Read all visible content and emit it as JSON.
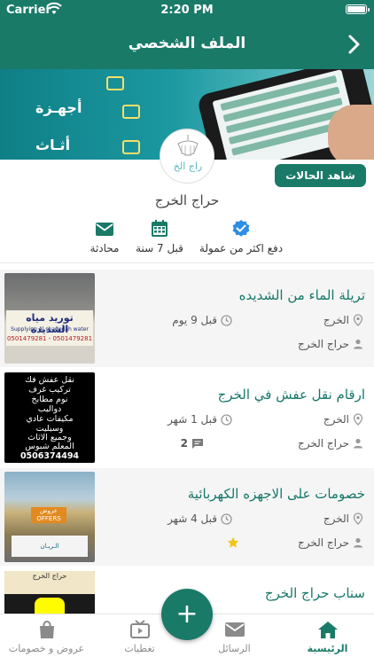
{
  "status_bar": {
    "carrier": "Carrier",
    "time": "2:20 PM"
  },
  "header": {
    "title": "الملف الشخصي",
    "back_icon": "chevron-right-icon"
  },
  "banner": {
    "lines": [
      "أجهـزة",
      "أثـاث"
    ]
  },
  "avatar": {
    "logo_text": "راج الخ"
  },
  "profile": {
    "status_button": "شاهد الحالات",
    "name": "حراج الخرج",
    "stats": [
      {
        "icon": "verified-badge-icon",
        "label": "دفع اكثر من عمولة"
      },
      {
        "icon": "calendar-icon",
        "label": "قبل 7 سنة"
      },
      {
        "icon": "message-icon",
        "label": "محادثة"
      }
    ]
  },
  "listings": [
    {
      "title": "تريلة الماء من الشديده",
      "location": "الخرج",
      "time": "قبل 9 يوم",
      "author": "حراج الخرج",
      "thumb_text": [
        "توريد مياه الشديدة",
        "Supplying Al shadedah water",
        "0501479281 - 0501479281"
      ]
    },
    {
      "title": "ارقام نقل عفش في الخرج",
      "location": "الخرج",
      "time": "قبل 1 شهر",
      "author": "حراج الخرج",
      "comments": "2",
      "thumb_text": [
        "نقل عفش فك",
        "تركيب غرف",
        "نوم مطابخ",
        "دواليب",
        "مكيفات عادي",
        "وسبليت",
        "وجميع الاثاث",
        "المعلم شبوس",
        "0506374494"
      ]
    },
    {
      "title": "خصومات على الاجهزه الكهربائية",
      "location": "الخرج",
      "time": "قبل 4 شهر",
      "author": "حراج الخرج",
      "thumb_text": [
        "عروض OFFERS",
        "الـريـان"
      ]
    },
    {
      "title": "سناب حراج الخرج",
      "thumb_text": [
        "حراج الخرج"
      ]
    }
  ],
  "tabbar": {
    "tabs": [
      {
        "label": "عروض و خصومات",
        "icon": "shopping-bag-icon"
      },
      {
        "label": "تغطيات",
        "icon": "video-icon"
      },
      {
        "label": "الرسائل",
        "icon": "envelope-icon"
      },
      {
        "label": "الرئيسية",
        "icon": "home-icon"
      }
    ],
    "fab_label": "+"
  },
  "colors": {
    "primary": "#1a7a68",
    "title_text": "#17776a",
    "badge_blue": "#2d8ee3",
    "star": "#f4c51a"
  }
}
